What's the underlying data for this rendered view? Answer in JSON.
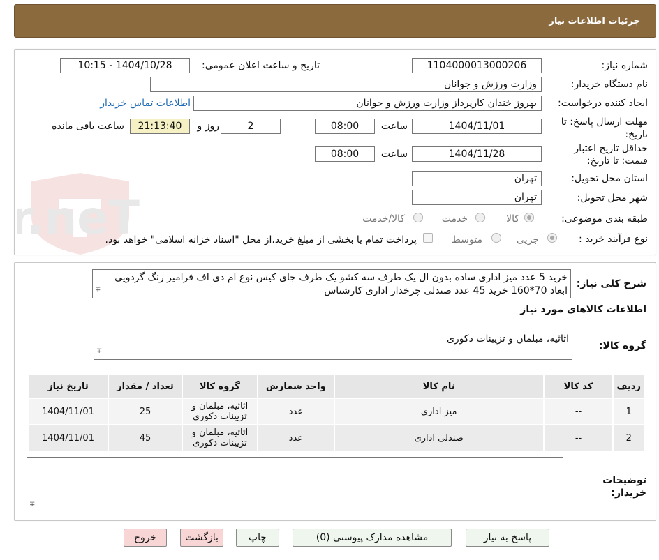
{
  "header": {
    "title": "جزئیات اطلاعات نیاز"
  },
  "form": {
    "need_number_label": "شماره نیاز:",
    "need_number": "1104000013000206",
    "announce_label": "تاریخ و ساعت اعلان عمومی:",
    "announce_value": "1404/10/28 - 10:15",
    "buyer_org_label": "نام دستگاه خریدار:",
    "buyer_org": "وزارت ورزش و جوانان",
    "creator_label": "ایجاد کننده درخواست:",
    "creator": "بهروز  خندان  کارپرداز وزارت ورزش و جوانان",
    "contact_link": "اطلاعات تماس خریدار",
    "deadline_label": "مهلت ارسال پاسخ: تا تاریخ:",
    "deadline_date": "1404/11/01",
    "time_label": "ساعت",
    "deadline_time": "08:00",
    "days_value": "2",
    "days_label": "روز و",
    "countdown": "21:13:40",
    "remaining_label": "ساعت باقی مانده",
    "validity_label": "حداقل تاریخ اعتبار قیمت: تا تاریخ:",
    "validity_date": "1404/11/28",
    "validity_time": "08:00",
    "province_label": "استان محل تحویل:",
    "province": "تهران",
    "city_label": "شهر محل تحویل:",
    "city": "تهران",
    "category_label": "طبقه بندی موضوعی:",
    "category_options": [
      "کالا",
      "خدمت",
      "کالا/خدمت"
    ],
    "process_label": "نوع فرآیند خرید :",
    "process_options": [
      "جزیی",
      "متوسط"
    ],
    "payment_note": "پرداخت تمام یا بخشی از مبلغ خرید،از محل \"اسناد خزانه اسلامی\" خواهد بود."
  },
  "watermark": {
    "text": "AriaTender.neT"
  },
  "description": {
    "label": "شرح کلی نیاز:",
    "text": "خرید 5 عدد میز اداری ساده بدون ال یک طرف سه کشو یک طرف جای کیس نوع ام دی اف فرامیر رنگ گردویی ابعاد 70*160 خرید 45 عدد صندلی چرخدار اداری کارشناس"
  },
  "goods": {
    "section_title": "اطلاعات کالاهای مورد نیاز",
    "group_label": "گروه کالا:",
    "group_value": "اثاثیه، مبلمان و تزیینات دکوری",
    "table": {
      "headers": [
        "ردیف",
        "کد کالا",
        "نام کالا",
        "واحد شمارش",
        "گروه کالا",
        "تعداد / مقدار",
        "تاریخ نیاز"
      ],
      "rows": [
        {
          "row": "1",
          "code": "--",
          "name": "میز اداری",
          "unit": "عدد",
          "group": "اثاثیه، مبلمان و تزیینات دکوری",
          "qty": "25",
          "date": "1404/11/01"
        },
        {
          "row": "2",
          "code": "--",
          "name": "صندلی اداری",
          "unit": "عدد",
          "group": "اثاثیه، مبلمان و تزیینات دکوری",
          "qty": "45",
          "date": "1404/11/01"
        }
      ]
    }
  },
  "buyer_notes": {
    "label": "توضیحات خریدار:",
    "value": ""
  },
  "buttons": {
    "reply": "پاسخ به نیاز",
    "attachments": "مشاهده مدارک پیوستی (0)",
    "print": "چاپ",
    "back": "بازگشت",
    "exit": "خروج"
  }
}
